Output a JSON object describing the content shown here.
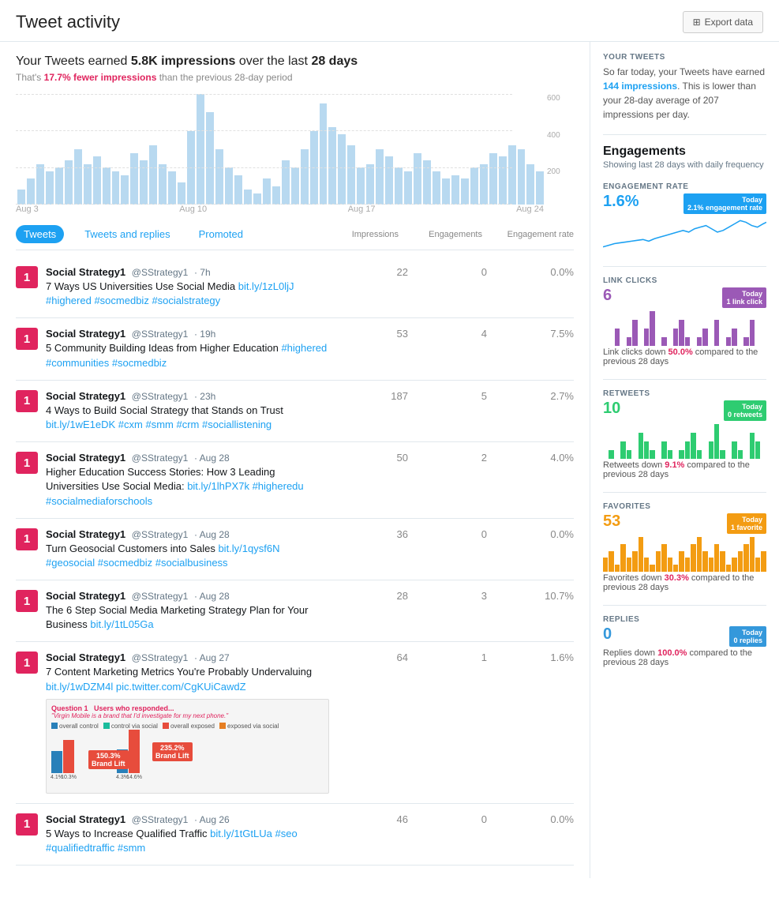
{
  "header": {
    "title": "Tweet activity",
    "export_button": "Export data"
  },
  "summary": {
    "line1_prefix": "Your Tweets earned ",
    "line1_highlight": "5.8K impressions",
    "line1_suffix": " over the last ",
    "line1_days": "28 days",
    "line2_prefix": "That's ",
    "line2_change": "17.7% fewer impressions",
    "line2_suffix": " than the previous 28-day period"
  },
  "chart": {
    "y_labels": [
      "600",
      "400",
      "200",
      ""
    ],
    "x_labels": [
      "Aug 3",
      "Aug 10",
      "Aug 17",
      "Aug 24"
    ],
    "bars": [
      8,
      14,
      22,
      18,
      20,
      24,
      30,
      22,
      26,
      20,
      18,
      16,
      28,
      24,
      32,
      22,
      18,
      12,
      40,
      60,
      50,
      30,
      20,
      16,
      8,
      6,
      14,
      10,
      24,
      20,
      30,
      40,
      55,
      42,
      38,
      32,
      20,
      22,
      30,
      26,
      20,
      18,
      28,
      24,
      18,
      14,
      16,
      14,
      20,
      22,
      28,
      26,
      32,
      30,
      22,
      18
    ]
  },
  "tabs": {
    "items": [
      "Tweets",
      "Tweets and replies",
      "Promoted"
    ],
    "active": 0
  },
  "columns": {
    "impressions": "Impressions",
    "engagements": "Engagements",
    "rate": "Engagement rate"
  },
  "tweets": [
    {
      "rank": "1",
      "author": "Social Strategy1",
      "handle": "@SStrategy1",
      "time": "· 7h",
      "text": "7 Ways US Universities Use Social Media bit.ly/1zL0ljJ #highered #socmedbiz #socialstrategy",
      "link": "bit.ly/1zL0ljJ",
      "hashtags": [
        "#highered",
        "#socmedbiz",
        "#socialstrategy"
      ],
      "impressions": "22",
      "engagements": "0",
      "rate": "0.0%"
    },
    {
      "rank": "1",
      "author": "Social Strategy1",
      "handle": "@SStrategy1",
      "time": "· 19h",
      "text": "5 Community Building Ideas from Higher Education #highered #communities #socmedbiz",
      "link": "",
      "hashtags": [
        "#highered",
        "#communities",
        "#socmedbiz"
      ],
      "impressions": "53",
      "engagements": "4",
      "rate": "7.5%"
    },
    {
      "rank": "1",
      "author": "Social Strategy1",
      "handle": "@SStrategy1",
      "time": "· 23h",
      "text": "4 Ways to Build Social Strategy that Stands on Trust bit.ly/1wE1eDK #cxm #smm #crm #sociallistening",
      "link": "bit.ly/1wE1eDK",
      "hashtags": [
        "#cxm",
        "#smm",
        "#crm",
        "#sociallistening"
      ],
      "impressions": "187",
      "engagements": "5",
      "rate": "2.7%"
    },
    {
      "rank": "1",
      "author": "Social Strategy1",
      "handle": "@SStrategy1",
      "time": "· Aug 28",
      "text": "Higher Education Success Stories: How 3 Leading Universities Use Social Media: bit.ly/1lhPX7k #higheredu #socialmediaforschools",
      "link": "bit.ly/1lhPX7k",
      "hashtags": [
        "#higheredu",
        "#socialmediaforschools"
      ],
      "impressions": "50",
      "engagements": "2",
      "rate": "4.0%"
    },
    {
      "rank": "1",
      "author": "Social Strategy1",
      "handle": "@SStrategy1",
      "time": "· Aug 28",
      "text": "Turn Geosocial Customers into Sales bit.ly/1qysf6N #geosocial #socmedbiz #socialbusiness",
      "link": "bit.ly/1qysf6N",
      "hashtags": [
        "#geosocial",
        "#socmedbiz",
        "#socialbusiness"
      ],
      "impressions": "36",
      "engagements": "0",
      "rate": "0.0%"
    },
    {
      "rank": "1",
      "author": "Social Strategy1",
      "handle": "@SStrategy1",
      "time": "· Aug 28",
      "text": "The 6 Step Social Media Marketing Strategy Plan for Your Business bit.ly/1tL05Ga",
      "link": "bit.ly/1tL05Ga",
      "hashtags": [],
      "impressions": "28",
      "engagements": "3",
      "rate": "10.7%"
    },
    {
      "rank": "1",
      "author": "Social Strategy1",
      "handle": "@SStrategy1",
      "time": "· Aug 27",
      "text": "7 Content Marketing Metrics You're Probably Undervaluing bit.ly/1wDZM4l pic.twitter.com/CgKUiCawdZ",
      "link": "bit.ly/1wDZM4l",
      "pic_link": "pic.twitter.com/CgKUiCawdZ",
      "hashtags": [],
      "impressions": "64",
      "engagements": "1",
      "rate": "1.6%",
      "has_card": true
    },
    {
      "rank": "1",
      "author": "Social Strategy1",
      "handle": "@SStrategy1",
      "time": "· Aug 26",
      "text": "5 Ways to Increase Qualified Traffic bit.ly/1tGtLUa #seo #qualifiedtraffic #smm",
      "link": "bit.ly/1tGtLUa",
      "hashtags": [
        "#seo",
        "#qualifiedtraffic",
        "#smm"
      ],
      "impressions": "46",
      "engagements": "0",
      "rate": "0.0%"
    }
  ],
  "right_panel": {
    "your_tweets_title": "YOUR TWEETS",
    "your_tweets_body": "So far today, your Tweets have earned 144 impressions. This is lower than your 28-day average of 207 impressions per day.",
    "your_tweets_highlight": "144 impressions",
    "engagements_title": "Engagements",
    "engagements_sub": "Showing last 28 days with daily frequency",
    "engagement_rate": {
      "label": "ENGAGEMENT RATE",
      "value": "1.6%",
      "today_badge": "Today",
      "today_value": "2.1% engagement rate",
      "badge_color": "#1da1f2"
    },
    "link_clicks": {
      "label": "LINK CLICKS",
      "value": "6",
      "today_badge": "Today",
      "today_value": "1 link click",
      "badge_color": "#9b59b6",
      "change_text": "Link clicks down 50.0% compared to the previous 28 days",
      "change_pct": "50.0%"
    },
    "retweets": {
      "label": "RETWEETS",
      "value": "10",
      "today_badge": "Today",
      "today_value": "0 retweets",
      "badge_color": "#2ecc71",
      "change_text": "Retweets down 9.1% compared to the previous 28 days",
      "change_pct": "9.1%"
    },
    "favorites": {
      "label": "FAVORITES",
      "value": "53",
      "today_badge": "Today",
      "today_value": "1 favorite",
      "badge_color": "#f39c12",
      "change_text": "Favorites down 30.3% compared to the previous 28 days",
      "change_pct": "30.3%"
    },
    "replies": {
      "label": "REPLIES",
      "value": "0",
      "today_badge": "Today",
      "today_value": "0 replies",
      "badge_color": "#3498db",
      "change_text": "Replies down 100.0% compared to the previous 28 days",
      "change_pct": "100.0%"
    }
  }
}
